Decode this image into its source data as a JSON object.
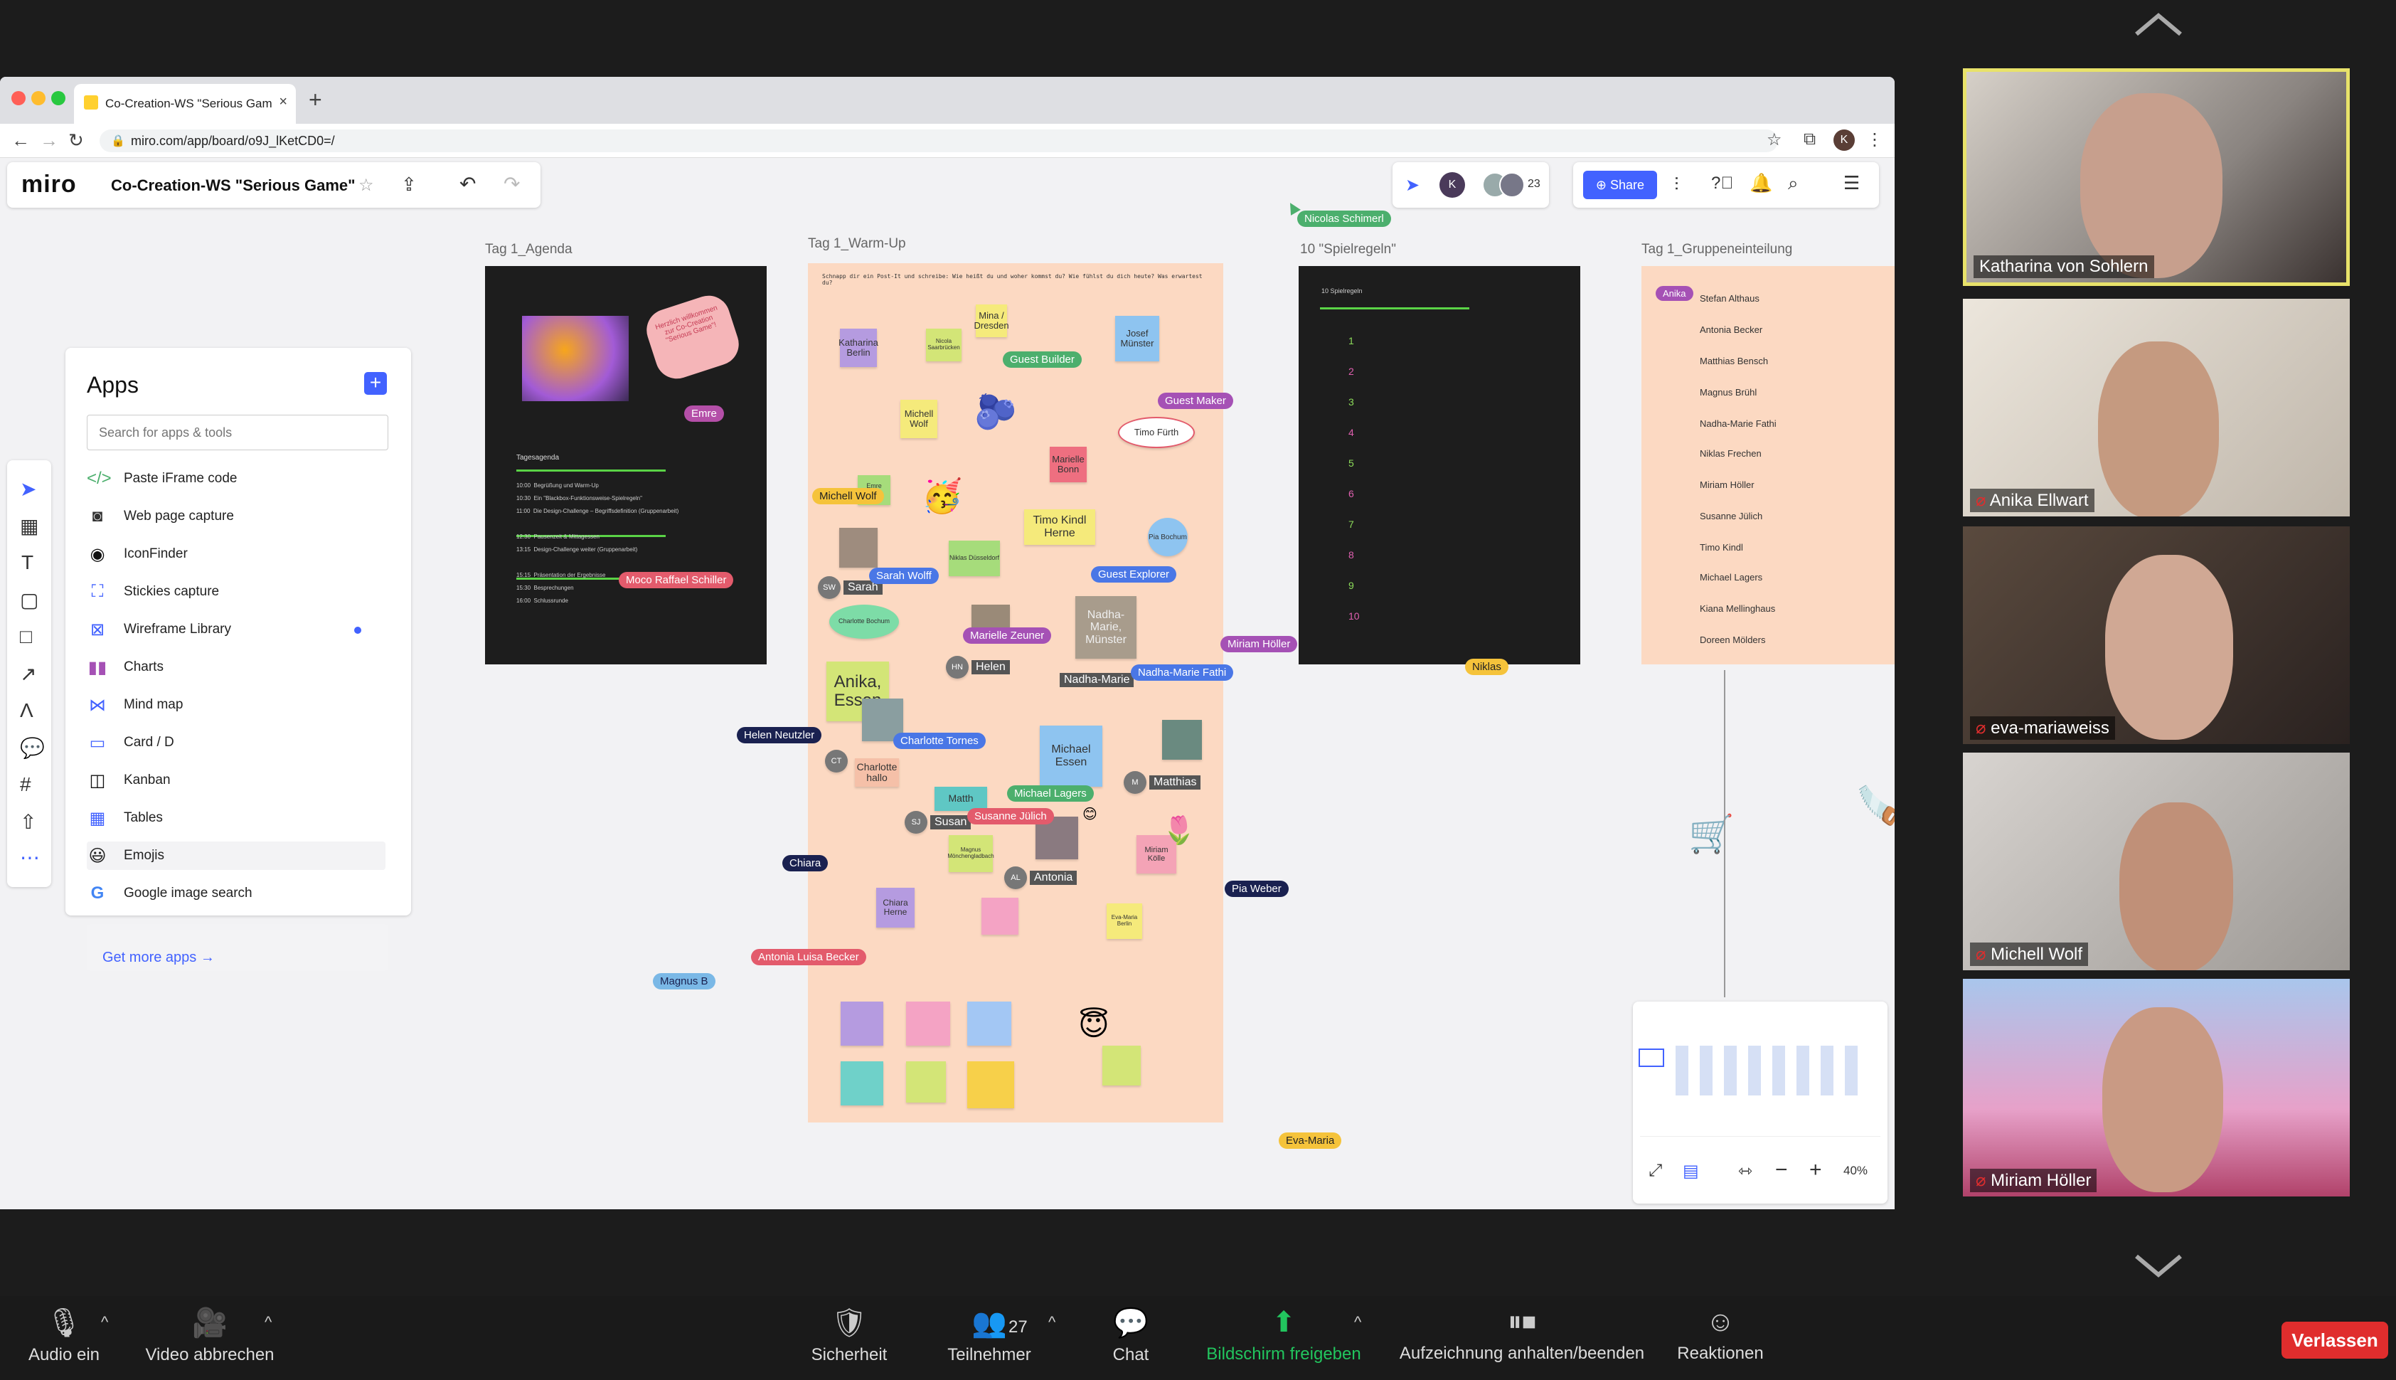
{
  "browser": {
    "tab_title": "Co-Creation-WS \"Serious Gam",
    "url": "miro.com/app/board/o9J_lKetCD0=/"
  },
  "miro": {
    "logo": "miro",
    "board_title": "Co-Creation-WS \"Serious Game\"",
    "share_label": "Share",
    "collaborator_count": "23",
    "avatar_initial": "K",
    "zoom_level": "40%",
    "frames": {
      "agenda": "Tag 1_Agenda",
      "warmup": "Tag 1_Warm-Up",
      "rules": "10 \"Spielregeln\"",
      "groups": "Tag 1_Gruppeneinteilung"
    },
    "apps": {
      "title": "Apps",
      "search_placeholder": "Search for apps & tools",
      "get_more": "Get more apps →",
      "items": [
        "Paste iFrame code",
        "Web page capture",
        "IconFinder",
        "Stickies capture",
        "Wireframe Library",
        "Charts",
        "Mind map",
        "Card / D",
        "Kanban",
        "Tables",
        "Emojis",
        "Google image search"
      ]
    },
    "rules_numbers": [
      "1",
      "2",
      "3",
      "4",
      "5",
      "6",
      "7",
      "8",
      "9",
      "10"
    ],
    "rules_heading": "10 Spielregeln",
    "groups_names": [
      "Stefan Althaus",
      "Antonia Becker",
      "Matthias Bensch",
      "Magnus Brühl",
      "Nadha-Marie Fathi",
      "Niklas Frechen",
      "Miriam Höller",
      "Susanne Jülich",
      "Timo Kindl",
      "Michael Lagers",
      "Kiana Mellinghaus",
      "Doreen Mölders"
    ],
    "cursors": [
      {
        "name": "Nicolas Schimerl",
        "color": "#4caf6d"
      },
      {
        "name": "Emre",
        "color": "#b44fa8"
      },
      {
        "name": "Moco Raffael Schiller",
        "color": "#e35b6c"
      },
      {
        "name": "Guest Builder",
        "color": "#4caf6d"
      },
      {
        "name": "Guest Maker",
        "color": "#a551b5"
      },
      {
        "name": "Michell Wolf",
        "color": "#f5c33b"
      },
      {
        "name": "Timo Kindl",
        "color": "#fff"
      },
      {
        "name": "Guest Explorer",
        "color": "#4a77e6"
      },
      {
        "name": "Sarah Wolff",
        "color": "#4a77e6"
      },
      {
        "name": "Marielle Zeuner",
        "color": "#a551b5"
      },
      {
        "name": "Miriam Höller",
        "color": "#a551b5"
      },
      {
        "name": "Nadha-Marie Fathi",
        "color": "#4a77e6"
      },
      {
        "name": "Niklas",
        "color": "#f5c33b"
      },
      {
        "name": "Helen Neutzler",
        "color": "#1a2150"
      },
      {
        "name": "Charlotte Tornes",
        "color": "#4a77e6"
      },
      {
        "name": "Michael Lagers",
        "color": "#4caf6d"
      },
      {
        "name": "Susanne Jülich",
        "color": "#e35b6c"
      },
      {
        "name": "Chiara",
        "color": "#1a2150"
      },
      {
        "name": "Pia Weber",
        "color": "#1a2150"
      },
      {
        "name": "Antonia Luisa Becker",
        "color": "#e35b6c"
      },
      {
        "name": "Magnus B",
        "color": "#7ab8e6"
      },
      {
        "name": "Eva-Maria",
        "color": "#f5c33b"
      },
      {
        "name": "Anika",
        "color": "#a551b5"
      }
    ],
    "sticky_notes": {
      "katharina": "Katharina Berlin",
      "mina": "Mina / Dresden",
      "josef": "Josef Münster",
      "nicola": "Nicola Saarbrücken",
      "michell": "Michell Wolf",
      "marielle": "Marielle Bonn",
      "timo_circle": "Timo Fürth",
      "timo_kindl": "Timo Kindl Herne",
      "emre_sticky": "Emre Berlin",
      "niklas": "Niklas Düsseldorf",
      "pia": "Pia Bochum",
      "sarah": "Sarah",
      "charlotte": "Charlotte Bochum",
      "anika": "Anika, Essen",
      "helen": "Helen",
      "nadha": "Nadha-Marie",
      "nadha_m": "Nadha-Marie, Münster",
      "michael": "Michael Essen",
      "matthias": "Matthias",
      "charlotte_hallo": "Charlotte hallo",
      "susanne": "Susan",
      "magnus": "Magnus Mönchengladbach",
      "antonia": "Antonia",
      "miriam": "Miriam Kölle",
      "chiara": "Chiara Herne",
      "eva": "Eva-Maria Berlin",
      "matth": "Matth"
    },
    "avatar_labels": {
      "sw": "SW",
      "hn": "HN",
      "ct": "CT",
      "sj": "SJ",
      "al": "AL",
      "m": "M"
    },
    "agenda": {
      "heading": "Tagesagenda",
      "bubble": "Herzlich willkommen zur Co-Creation \"Serious Game\"!",
      "rows": [
        "Begrüßung und Warm-Up",
        "Ein \"Blackbox-Funktionsweise-Spielregeln\"",
        "Die Design-Challenge – Begriffsdefinition (Gruppenarbeit)",
        "",
        "Pausenzeit & Mittagessen",
        "Design-Challenge weiter (Gruppenarbeit)",
        "",
        "Präsentation der Ergebnisse",
        "Besprechungen",
        "Schlussrunde"
      ],
      "times": [
        "10:00",
        "10:30",
        "11:00",
        "",
        "12:30",
        "13:15",
        "",
        "15:15",
        "15:30",
        "16:00"
      ]
    },
    "warmup_intro": "Schnapp dir ein Post-It und schreibe: Wie heißt du und woher kommst du? Wie fühlst du dich heute? Was erwartest du?"
  },
  "zoom": {
    "participants": [
      {
        "name": "Katharina von Sohlern"
      },
      {
        "name": "Anika Ellwart"
      },
      {
        "name": "eva-mariaweiss"
      },
      {
        "name": "Michell Wolf"
      },
      {
        "name": "Miriam Höller"
      }
    ],
    "bottombar": {
      "audio": "Audio ein",
      "video": "Video abbrechen",
      "security": "Sicherheit",
      "participants": "Teilnehmer",
      "participants_count": "27",
      "chat": "Chat",
      "share": "Bildschirm freigeben",
      "record": "Aufzeichnung anhalten/beenden",
      "reactions": "Reaktionen",
      "leave": "Verlassen"
    }
  },
  "colors": {
    "share_green": "#22c55e",
    "leave_red": "#e02d2d",
    "miro_blue": "#4262ff",
    "active_border": "#e8e26a"
  }
}
